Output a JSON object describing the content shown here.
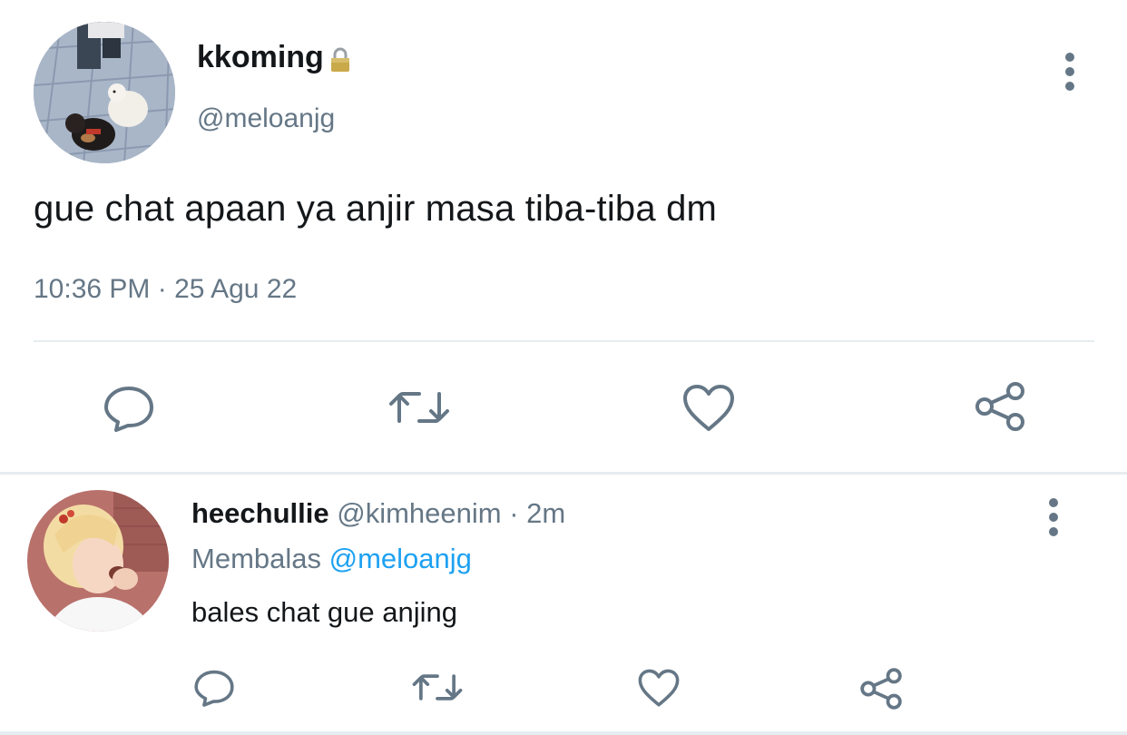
{
  "tweet": {
    "display_name": "kkoming",
    "handle": "@meloanjg",
    "text": "gue chat apaan ya anjir masa tiba-tiba dm",
    "timestamp": "10:36 PM · 25 Agu 22",
    "icons": {
      "locked": "lock-icon",
      "more": "kebab-icon",
      "reply": "reply-icon",
      "retweet": "retweet-icon",
      "like": "heart-icon",
      "share": "share-icon"
    }
  },
  "reply": {
    "display_name": "heechullie",
    "handle": "@kimheenim",
    "separator": "·",
    "time": "2m",
    "replying_prefix": "Membalas",
    "replying_to": "@meloanjg",
    "text": "bales chat gue anjing"
  },
  "colors": {
    "text_primary": "#14171a",
    "text_secondary": "#657786",
    "link": "#1da1f2",
    "divider": "#e6ecf0",
    "icon": "#657786"
  }
}
